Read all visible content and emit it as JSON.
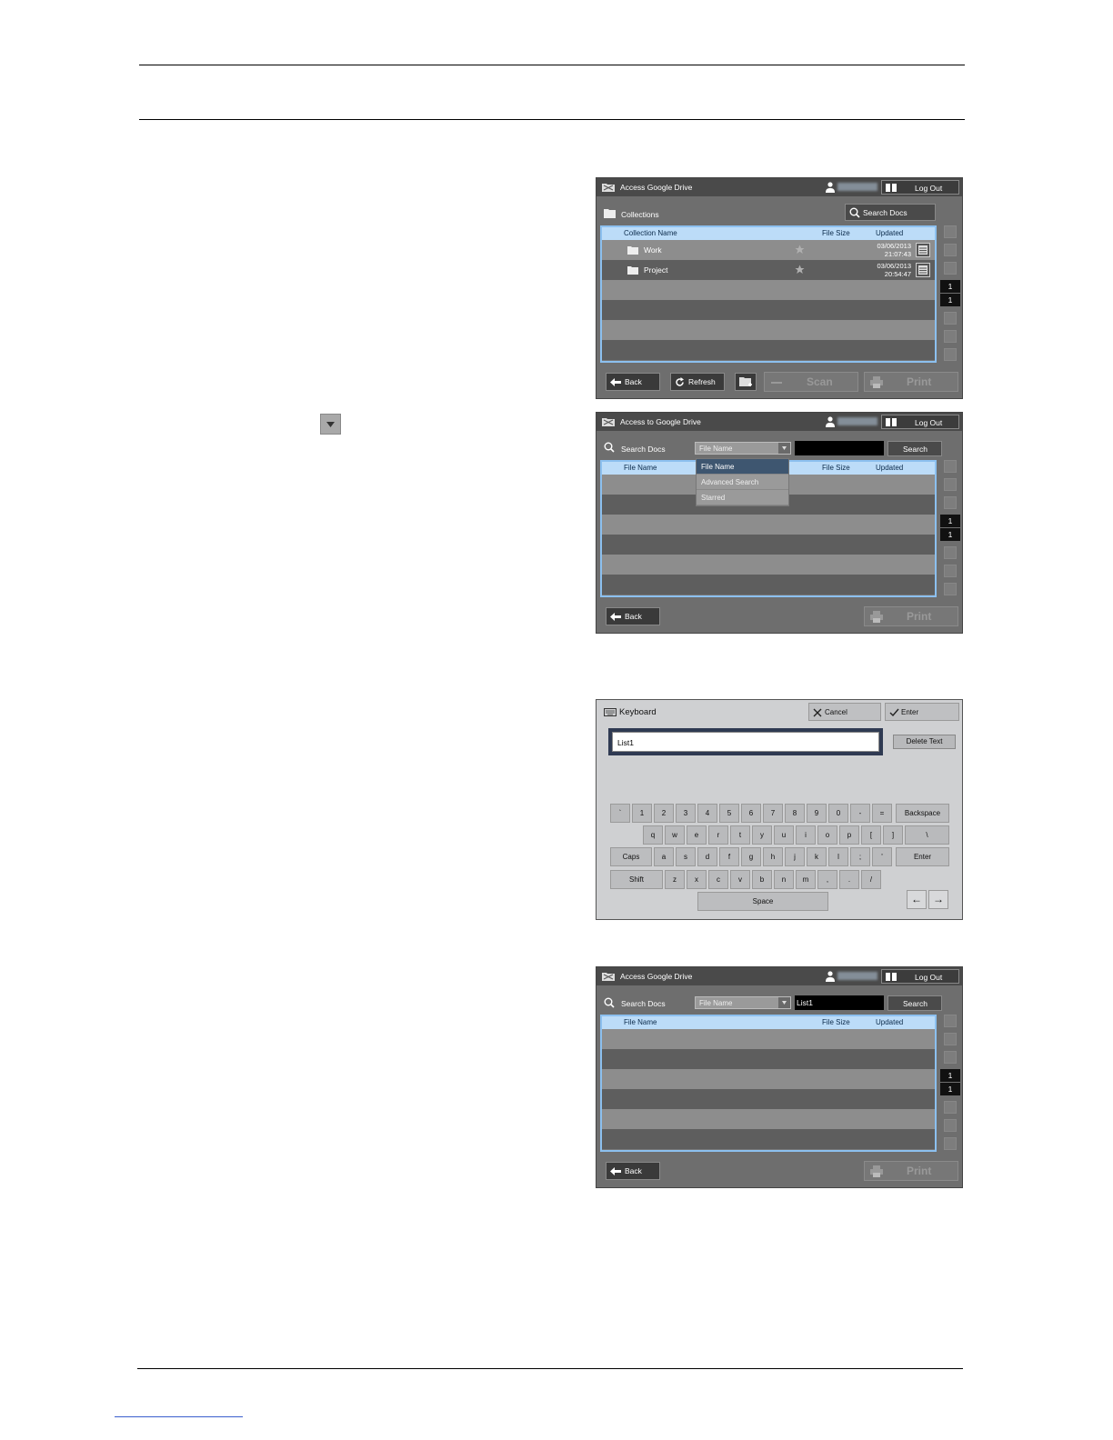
{
  "screen1": {
    "title": "Access Google Drive",
    "logout": "Log Out",
    "collections": "Collections",
    "search_docs": "Search Docs",
    "columns": [
      "Collection Name",
      "File Size",
      "Updated"
    ],
    "rows": [
      {
        "name": "Work",
        "date": "03/06/2013",
        "time": "21:07:43"
      },
      {
        "name": "Project",
        "date": "03/06/2013",
        "time": "20:54:47"
      }
    ],
    "page_current": "1",
    "page_total": "1",
    "buttons": {
      "back": "Back",
      "refresh": "Refresh",
      "scan": "Scan",
      "print": "Print"
    }
  },
  "screen2": {
    "title": "Access to Google Drive",
    "logout": "Log Out",
    "search_docs": "Search Docs",
    "dropdown_value": "File Name",
    "search_button": "Search",
    "columns": [
      "File Name",
      "File Size",
      "Updated"
    ],
    "menu_options": [
      "File Name",
      "Advanced Search",
      "Starred"
    ],
    "page_current": "1",
    "page_total": "1",
    "buttons": {
      "back": "Back",
      "print": "Print"
    }
  },
  "keyboard": {
    "title": "Keyboard",
    "cancel": "Cancel",
    "enter": "Enter",
    "input_value": "List1",
    "delete_text": "Delete Text",
    "row1": [
      "`",
      "1",
      "2",
      "3",
      "4",
      "5",
      "6",
      "7",
      "8",
      "9",
      "0",
      "-",
      "=",
      "Backspace"
    ],
    "row2": [
      "q",
      "w",
      "e",
      "r",
      "t",
      "y",
      "u",
      "i",
      "o",
      "p",
      "[",
      "]",
      "\\"
    ],
    "row3": [
      "Caps",
      "a",
      "s",
      "d",
      "f",
      "g",
      "h",
      "j",
      "k",
      "l",
      ";",
      "'",
      "Enter"
    ],
    "row4": [
      "Shift",
      "z",
      "x",
      "c",
      "v",
      "b",
      "n",
      "m",
      ",",
      ".",
      "/"
    ],
    "space": "Space",
    "left_arrow": "←",
    "right_arrow": "→"
  },
  "screen3": {
    "title": "Access Google Drive",
    "logout": "Log Out",
    "search_docs": "Search Docs",
    "dropdown_value": "File Name",
    "search_value": "List1",
    "search_button": "Search",
    "columns": [
      "File Name",
      "File Size",
      "Updated"
    ],
    "page_current": "1",
    "page_total": "1",
    "buttons": {
      "back": "Back",
      "print": "Print"
    }
  },
  "colors": {
    "panel": "#6e6e6e",
    "header": "#bcdcf8",
    "border": "#8cc0ef"
  }
}
